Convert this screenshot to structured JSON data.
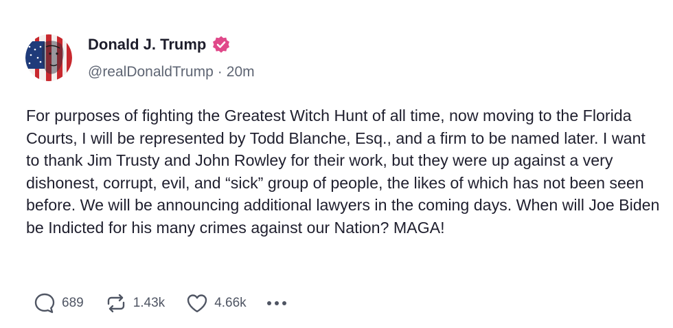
{
  "post": {
    "author": {
      "display_name": "Donald J. Trump",
      "handle": "@realDonaldTrump",
      "verified": true
    },
    "separator": "·",
    "time_ago": "20m",
    "text": "For purposes of fighting the Greatest Witch Hunt of all time, now moving to the Florida Courts, I will be represented by Todd Blanche, Esq., and a firm to be named later. I want to thank Jim Trusty and John Rowley for their work, but they were up against a very dishonest, corrupt, evil, and “sick” group of people, the likes of which has not been seen before. We will be announcing additional lawyers in the coming days. When will Joe Biden be Indicted for his many crimes against our Nation? MAGA!"
  },
  "actions": {
    "replies": "689",
    "retruths": "1.43k",
    "likes": "4.66k"
  },
  "icons": {
    "reply": "speech-bubble-icon",
    "retruth": "retruth-arrows-icon",
    "like": "heart-icon",
    "more": "more-horizontal-icon",
    "verified": "verified-badge-icon"
  },
  "colors": {
    "text": "#1f1f2e",
    "muted": "#5e6573",
    "verified_badge": "#e0498a"
  }
}
